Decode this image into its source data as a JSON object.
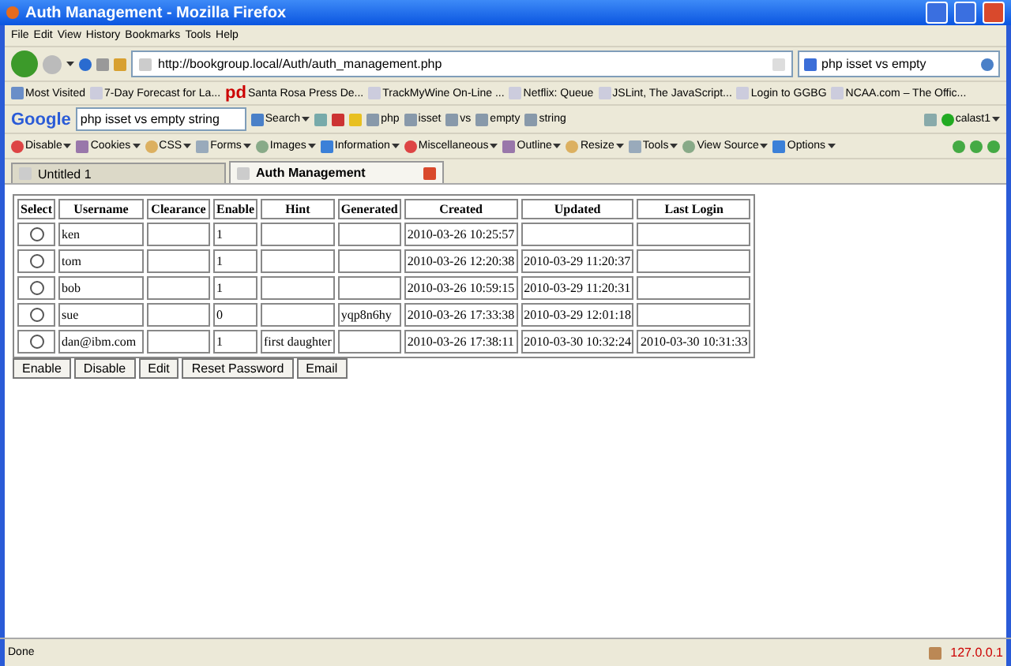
{
  "window": {
    "title": "Auth Management - Mozilla Firefox"
  },
  "menu": [
    "File",
    "Edit",
    "View",
    "History",
    "Bookmarks",
    "Tools",
    "Help"
  ],
  "navigation": {
    "url": "http://bookgroup.local/Auth/auth_management.php",
    "search": "php isset vs empty"
  },
  "bookmarks": [
    {
      "label": "Most Visited"
    },
    {
      "label": "7-Day Forecast for La..."
    },
    {
      "logo": "pd",
      "label": "Santa Rosa Press De..."
    },
    {
      "label": "TrackMyWine On-Line ..."
    },
    {
      "label": "Netflix: Queue"
    },
    {
      "label": "JSLint, The JavaScript..."
    },
    {
      "label": "Login to GGBG"
    },
    {
      "label": "NCAA.com – The Offic..."
    }
  ],
  "google_toolbar": {
    "logo": "Google",
    "query": "php isset vs empty string",
    "search": "Search",
    "terms": [
      "php",
      "isset",
      "vs",
      "empty",
      "string"
    ],
    "account": "calast1"
  },
  "developer_toolbar": [
    "Disable",
    "Cookies",
    "CSS",
    "Forms",
    "Images",
    "Information",
    "Miscellaneous",
    "Outline",
    "Resize",
    "Tools",
    "View Source",
    "Options"
  ],
  "tabs": [
    {
      "label": "Untitled 1",
      "selected": false
    },
    {
      "label": "Auth Management",
      "selected": true
    }
  ],
  "table": {
    "columns": [
      "Select",
      "Username",
      "Clearance",
      "Enable",
      "Hint",
      "Generated",
      "Created",
      "Updated",
      "Last Login"
    ],
    "rows": [
      {
        "selected": false,
        "cells": [
          "",
          "ken",
          "",
          "1",
          "",
          "",
          "2010-03-26 10:25:57",
          "",
          ""
        ]
      },
      {
        "selected": false,
        "cells": [
          "",
          "tom",
          "",
          "1",
          "",
          "",
          "2010-03-26 12:20:38",
          "2010-03-29 11:20:37",
          ""
        ]
      },
      {
        "selected": false,
        "cells": [
          "",
          "bob",
          "",
          "1",
          "",
          "",
          "2010-03-26 10:59:15",
          "2010-03-29 11:20:31",
          ""
        ]
      },
      {
        "selected": false,
        "cells": [
          "",
          "sue",
          "",
          "0",
          "",
          "yqp8n6hy",
          "2010-03-26 17:33:38",
          "2010-03-29 12:01:18",
          ""
        ]
      },
      {
        "selected": false,
        "cells": [
          "",
          "dan@ibm.com",
          "",
          "1",
          "first daughter",
          "",
          "2010-03-26 17:38:11",
          "2010-03-30 10:32:24",
          "2010-03-30 10:31:33"
        ]
      }
    ]
  },
  "buttons": [
    "Enable",
    "Disable",
    "Edit",
    "Reset Password",
    "Email"
  ],
  "status_bar": {
    "text": "Done",
    "address": "127.0.0.1"
  }
}
